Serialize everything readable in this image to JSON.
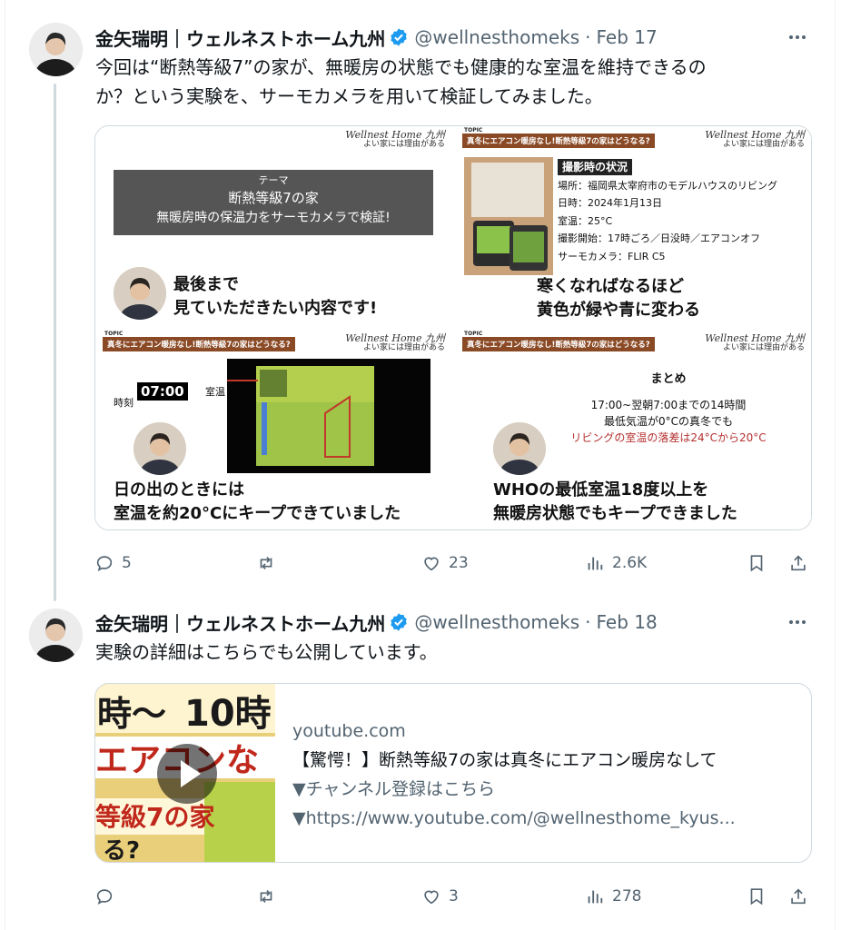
{
  "tweets": [
    {
      "display_name": "金矢瑞明｜ウェルネストホーム九州",
      "handle": "@wellnesthomeks",
      "separator": "·",
      "date": "Feb 17",
      "text_lines": [
        "今回は“断熱等級7”の家が、無暖房の状態でも健康的な室温を維持できるの",
        "か？という実験を、サーモカメラを用いて検証してみました。"
      ],
      "media": {
        "logo_main": "Wellnest Home 九州",
        "logo_sub": "よい家には理由がある",
        "topic_tag": "TOPIC",
        "topic_bar": "真冬にエアコン暖房なし!断熱等級7の家はどうなる?",
        "panel1": {
          "theme_label": "テーマ",
          "theme_line1": "断熱等級7の家",
          "theme_line2": "無暖房時の保温力をサーモカメラで検証!",
          "caption_line1": "最後まで",
          "caption_line2": "見ていただきたい内容です!"
        },
        "panel2": {
          "info_title": "撮影時の状況",
          "info_lines": [
            "場所：福岡県太宰府市のモデルハウスのリビング",
            "日時：2024年1月13日",
            "室温：25°C",
            "撮影開始：17時ごろ／日没時／エアコンオフ",
            "サーモカメラ：FLIR C5"
          ],
          "caption_line1": "寒くなればなるほど",
          "caption_line2": "黄色が緑や青に変わる"
        },
        "panel3": {
          "time_label": "時刻",
          "time_value": "07:00",
          "room_label": "室温",
          "caption_line1": "日の出のときには",
          "caption_line2": "室温を約20°Cにキープできていました"
        },
        "panel4": {
          "summary_head": "まとめ",
          "summary_line1": "17:00~翌朝7:00までの14時間",
          "summary_line2": "最低気温が0°Cの真冬でも",
          "summary_line3": "リビングの室温の落差は24°Cから20°C",
          "caption_line1": "WHOの最低室温18度以上を",
          "caption_line2": "無暖房状態でもキープできました"
        }
      },
      "actions": {
        "replies": "5",
        "retweets": "",
        "likes": "23",
        "views": "2.6K"
      }
    },
    {
      "display_name": "金矢瑞明｜ウェルネストホーム九州",
      "handle": "@wellnesthomeks",
      "separator": "·",
      "date": "Feb 18",
      "text": "実験の詳細はこちらでも公開しています。",
      "card": {
        "domain": "youtube.com",
        "title": "【驚愕！】断熱等級7の家は真冬にエアコン暖房なして",
        "desc_line1": "▼チャンネル登録はこちら",
        "desc_line2": "▼https://www.youtube.com/@wellnesthome_kyus..."
      },
      "actions": {
        "replies": "",
        "retweets": "",
        "likes": "3",
        "views": "278"
      }
    }
  ],
  "colors": {
    "verified": "#1d9bf0",
    "secondary_text": "#536471",
    "border": "#cfd9de",
    "topic_bar": "#8a4a26"
  }
}
